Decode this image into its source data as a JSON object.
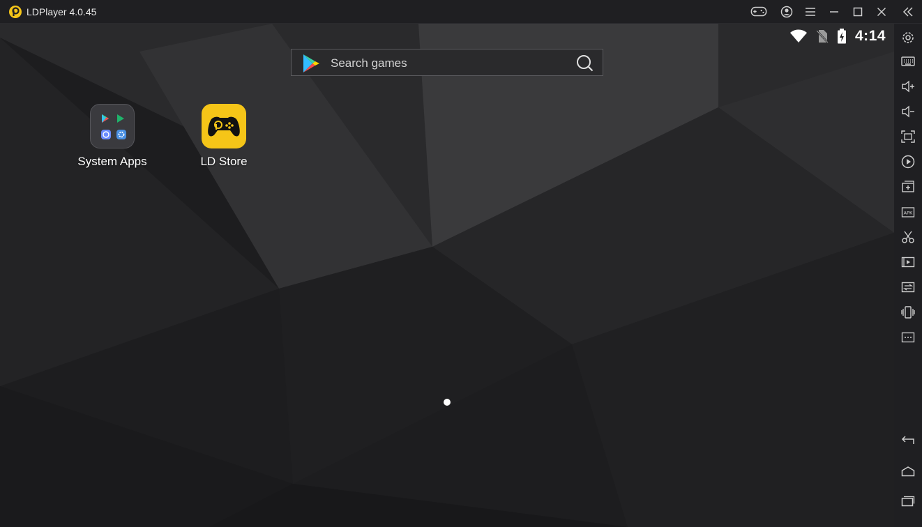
{
  "window": {
    "title": "LDPlayer 4.0.45",
    "accent": "#f5c518"
  },
  "titlebar_buttons": [
    {
      "name": "gamepad-icon"
    },
    {
      "name": "account-icon"
    },
    {
      "name": "menu-icon"
    },
    {
      "name": "minimize-icon"
    },
    {
      "name": "maximize-icon"
    },
    {
      "name": "close-icon"
    },
    {
      "name": "collapse-sidebar-icon"
    }
  ],
  "status_bar": {
    "time": "4:14",
    "icons": [
      "wifi-icon",
      "no-sim-icon",
      "battery-charging-icon"
    ]
  },
  "search": {
    "placeholder": "Search games"
  },
  "apps": [
    {
      "label": "System Apps",
      "icon": "system-apps-folder-icon"
    },
    {
      "label": "LD Store",
      "icon": "ld-store-icon"
    }
  ],
  "sidebar": {
    "tools": [
      "settings-icon",
      "keyboard-mapping-icon",
      "volume-up-icon",
      "volume-down-icon",
      "fullscreen-icon",
      "record-icon",
      "add-instance-icon",
      "install-apk-icon",
      "screenshot-scissors-icon",
      "video-record-icon",
      "sync-icon",
      "shake-icon",
      "more-icon"
    ],
    "nav": [
      "back-icon",
      "home-icon",
      "recent-apps-icon"
    ]
  }
}
